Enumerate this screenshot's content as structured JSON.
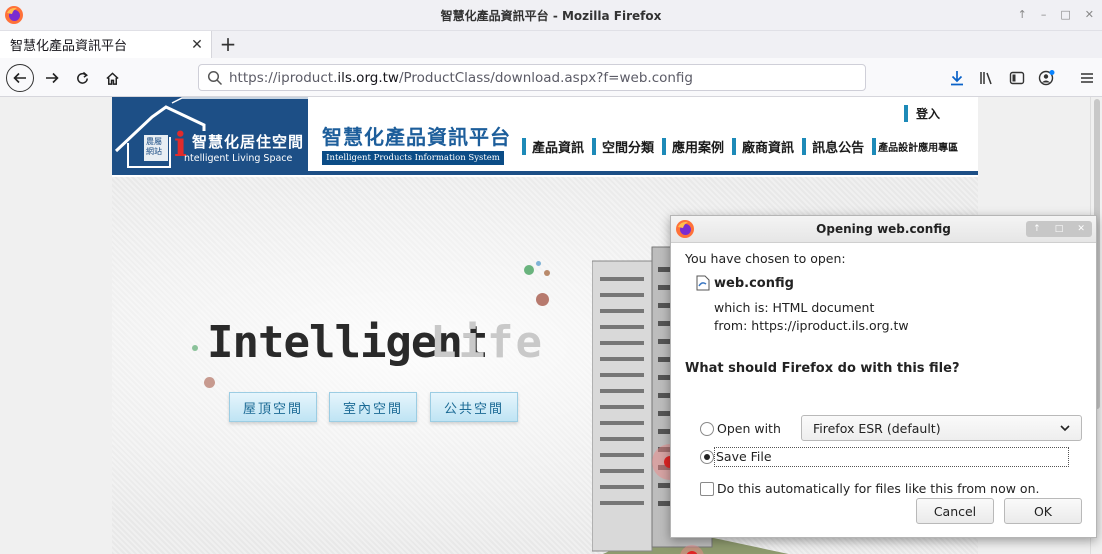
{
  "window": {
    "title": "智慧化產品資訊平台 - Mozilla Firefox",
    "controls": [
      "↑",
      "–",
      "□",
      "✕"
    ]
  },
  "tab": {
    "title": "智慧化產品資訊平台",
    "close": "✕",
    "new_tab": "+"
  },
  "navbar": {
    "url_prefix": "https://iproduct.",
    "url_domain": "ils.org.tw",
    "url_path": "/ProductClass/download.aspx?f=web.config"
  },
  "site": {
    "logo_main": "智慧化居住空間",
    "logo_sub": "ntelligent Living Space",
    "logo_i": "i",
    "logo_badge": "農屬網站",
    "title": "智慧化產品資訊平台",
    "subtitle": "Intelligent Products Information System",
    "login": "登入",
    "menu": [
      "產品資訊",
      "空間分類",
      "應用案例",
      "廠商資訊",
      "訊息公告",
      "產品設計應用專區"
    ],
    "hero_title": "Intelligent",
    "hero_title2": "Life",
    "hero_buttons": [
      "屋頂空間",
      "室內空間",
      "公共空間"
    ]
  },
  "dialog": {
    "title": "Opening web.config",
    "chosen": "You have chosen to open:",
    "filename": "web.config",
    "which_is": "which is: HTML document",
    "from": "from: https://iproduct.ils.org.tw",
    "question": "What should Firefox do with this file?",
    "open_with_label": "Open with",
    "open_with_value": "Firefox ESR (default)",
    "save_file_label": "Save File",
    "auto_label": "Do this automatically for files like this from now on.",
    "cancel": "Cancel",
    "ok": "OK",
    "selected_option": "save_file"
  },
  "colors": {
    "brand_blue": "#1d4f86",
    "menu_bar": "#1d8ab8",
    "logo_red": "#e12b2b"
  }
}
